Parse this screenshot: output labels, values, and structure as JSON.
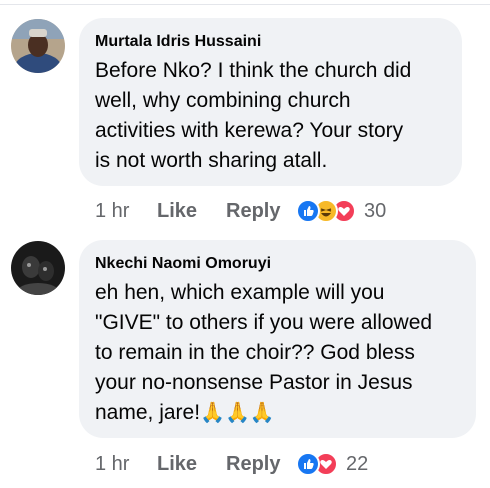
{
  "comments": [
    {
      "author": "Murtala Idris Hussaini",
      "text": "Before Nko? I think the church did\nwell, why combining church\nactivities with kerewa?  Your story\nis not worth sharing atall.",
      "time": "1 hr",
      "like_label": "Like",
      "reply_label": "Reply",
      "reactions": [
        "like-icon",
        "haha-icon",
        "love-icon"
      ],
      "reaction_count": "30"
    },
    {
      "author": "Nkechi Naomi Omoruyi",
      "text": "eh hen, which example will you\n\"GIVE\" to others if you were allowed\nto remain in the choir?? God bless\nyour no-nonsense Pastor in Jesus\nname, jare!",
      "emoji": "🙏🙏🙏",
      "time": "1 hr",
      "like_label": "Like",
      "reply_label": "Reply",
      "reactions": [
        "like-icon",
        "love-icon"
      ],
      "reaction_count": "22"
    }
  ],
  "colors": {
    "bubble": "#f0f2f5",
    "meta": "#65676b",
    "like_blue": "#1877f2",
    "love_red": "#f33e58",
    "haha_yellow": "#f7b928"
  }
}
